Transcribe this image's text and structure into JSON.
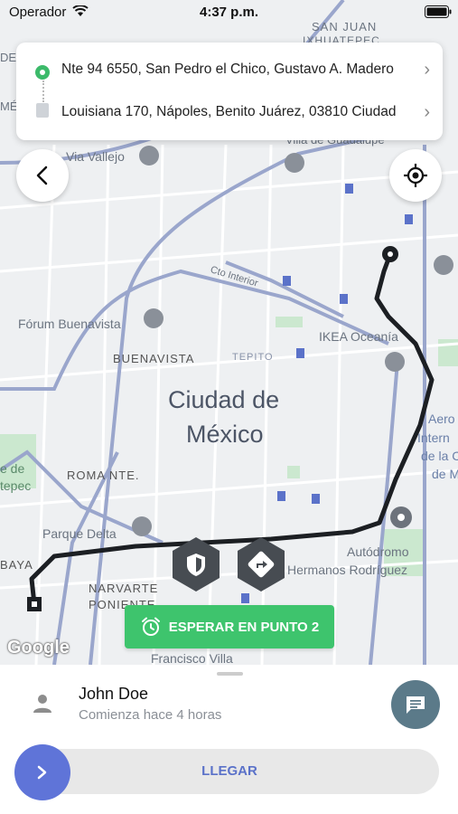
{
  "status_bar": {
    "carrier": "Operador",
    "time": "4:37 p.m."
  },
  "route": {
    "origin": "Nte 94 6550, San Pedro el Chico, Gustavo A. Madero",
    "destination": "Louisiana 170, Nápoles, Benito Juárez, 03810 Ciudad"
  },
  "map": {
    "city_label_line1": "Ciudad de",
    "city_label_line2": "México",
    "labels": {
      "san_juan": "SAN JUAN",
      "ixhuatepec": "IXHUATEPEC",
      "via_vallejo": "Via Vallejo",
      "guadalupe": "Villa de Guadalupe",
      "foro": "Fórum Buenavista",
      "buenavista": "BUENAVISTA",
      "tepito": "TEPITO",
      "ikea": "IKEA Oceanía",
      "aero": "Aero",
      "intern": "Intern",
      "de_la_c": "de la C",
      "de_m": "de M",
      "ede": "e de",
      "tepec": "tepec",
      "roma": "ROMA NTE.",
      "parque_delta": "Parque Delta",
      "autodromo": "Autódromo",
      "hermanos": "Hermanos Rodríguez",
      "baya": "BAYA",
      "narvarte": "NARVARTE",
      "poniente": "PONIENTE",
      "francisco": "Francisco Villa",
      "circuito": "Cto Interior",
      "google": "Google",
      "dep": "DE",
      "me": "MÉ"
    }
  },
  "wait_button": {
    "label": "ESPERAR EN PUNTO 2"
  },
  "driver": {
    "name": "John Doe",
    "subtitle": "Comienza hace 4 horas"
  },
  "arrive": {
    "label": "LLEGAR"
  },
  "colors": {
    "accent_green": "#3ec46d",
    "slider_blue": "#5f74d8",
    "chat_bg": "#5b7a89",
    "route": "#1c1f23"
  }
}
